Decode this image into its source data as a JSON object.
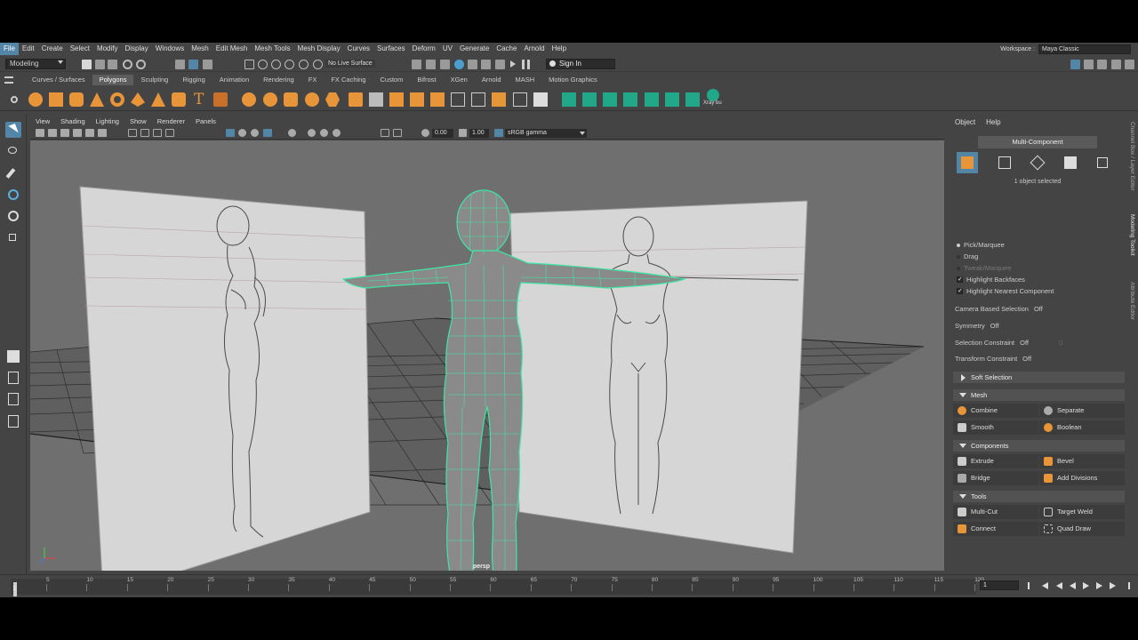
{
  "menu": [
    "File",
    "Edit",
    "Create",
    "Select",
    "Modify",
    "Display",
    "Windows",
    "Mesh",
    "Edit Mesh",
    "Mesh Tools",
    "Mesh Display",
    "Curves",
    "Surfaces",
    "Deform",
    "UV",
    "Generate",
    "Cache",
    "Arnold",
    "Help"
  ],
  "workspace": {
    "label": "Workspace :",
    "value": "Maya Classic"
  },
  "status": {
    "mode": "Modeling",
    "live_surface": "No Live Surface",
    "sign_in": "Sign In"
  },
  "shelf_tabs": [
    "Curves / Surfaces",
    "Polygons",
    "Sculpting",
    "Rigging",
    "Animation",
    "Rendering",
    "FX",
    "FX Caching",
    "Custom",
    "Bifrost",
    "XGen",
    "Arnold",
    "MASH",
    "Motion Graphics"
  ],
  "shelf_active": "Polygons",
  "xray_label": "Xray bu",
  "viewport": {
    "menu": [
      "View",
      "Shading",
      "Lighting",
      "Show",
      "Renderer",
      "Panels"
    ],
    "field_a": "0.00",
    "field_b": "1.00",
    "color_space": "sRGB gamma",
    "camera": "persp"
  },
  "timeline": {
    "ticks": [
      "5",
      "10",
      "15",
      "20",
      "25",
      "30",
      "35",
      "40",
      "45",
      "50",
      "55",
      "60",
      "65",
      "70",
      "75",
      "80",
      "85",
      "90",
      "95",
      "100",
      "105",
      "110",
      "115",
      "120"
    ],
    "current_frame": "1",
    "frame_field": "1"
  },
  "panel": {
    "menu": [
      "Object",
      "Help"
    ],
    "mode": "Multi-Component",
    "selected_text": "1 object selected",
    "options": [
      "Pick/Marquee",
      "Drag",
      "Tweak/Marquee"
    ],
    "checks": [
      "Highlight Backfaces",
      "Highlight Nearest Component"
    ],
    "rows": [
      {
        "label": "Camera Based Selection",
        "value": "Off"
      },
      {
        "label": "Symmetry",
        "value": "Off"
      },
      {
        "label": "Selection Constraint",
        "value": "Off",
        "extra": "0"
      },
      {
        "label": "Transform Constraint",
        "value": "Off"
      }
    ],
    "soft_selection": "Soft Selection",
    "sections": {
      "mesh": {
        "title": "Mesh",
        "buttons": [
          "Combine",
          "Separate",
          "Smooth",
          "Boolean"
        ]
      },
      "components": {
        "title": "Components",
        "buttons": [
          "Extrude",
          "Bevel",
          "Bridge",
          "Add Divisions"
        ]
      },
      "tools": {
        "title": "Tools",
        "buttons": [
          "Multi-Cut",
          "Target Weld",
          "Connect",
          "Quad Draw"
        ]
      }
    }
  },
  "side_tabs": [
    "Channel Box / Layer Editor",
    "Modeling Toolkit",
    "Attribute Editor"
  ],
  "colors": {
    "accent": "#5285a6",
    "poly_orange": "#e8953a",
    "wireframe": "#3ee6a6",
    "viewport_bg": "#6f6f6f",
    "shelf_green": "#20a888"
  }
}
